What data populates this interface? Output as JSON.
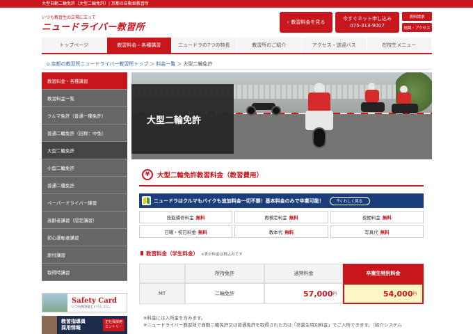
{
  "topbar": {
    "text": "大型自動二輪免許（大型二輪免許）| 京都の自動車教習所"
  },
  "header": {
    "logo_sub": "いつも教習生の立場に立って",
    "logo_main": "ニュードライバー教習所",
    "btn_fee": "教習料金を見る",
    "btn_apply": "今すぐネット申し込み",
    "btn_apply_tel": "075-313-9007",
    "btn_docs": "資料請求",
    "btn_map": "地図・アクセス"
  },
  "gnav": [
    {
      "label": "トップページ",
      "active": false
    },
    {
      "label": "教習料金・各種講習",
      "active": true
    },
    {
      "label": "ニュードラの7つの特長",
      "active": false
    },
    {
      "label": "教習所のご紹介",
      "active": false
    },
    {
      "label": "アクセス・送迎バス",
      "active": false
    },
    {
      "label": "在校生メニュー",
      "active": false
    }
  ],
  "breadcrumb": {
    "home": "京都の教習所ニュードライバー教習所トップ",
    "sep1": "＞",
    "level2": "料金一覧",
    "sep2": "＞",
    "current": "大型二輪免許"
  },
  "sidebar": {
    "items": [
      {
        "label": "教習料金・各種講習",
        "type": "header"
      },
      {
        "label": "教習料金一覧",
        "type": "normal"
      },
      {
        "label": "クルマ免許（普通一種免許）",
        "type": "normal"
      },
      {
        "label": "普通二輪免許（旧称：中免）",
        "type": "normal"
      },
      {
        "label": "大型二輪免許",
        "type": "current"
      },
      {
        "label": "小型二輪免許",
        "type": "normal"
      },
      {
        "label": "普通二種免許",
        "type": "normal"
      },
      {
        "label": "ペーパードライバー練習",
        "type": "normal"
      },
      {
        "label": "高齢者講習（認定講習）",
        "type": "normal"
      },
      {
        "label": "初心運転者講習",
        "type": "normal"
      },
      {
        "label": "原付講習",
        "type": "normal"
      },
      {
        "label": "取得時講習",
        "type": "normal"
      }
    ],
    "safety_title": "Safety Card",
    "safety_sub": "いつも免許証といっしょに。",
    "recruit_line1": "教習指導員",
    "recruit_line2": "採用情報",
    "recruit_entry_1": "正社員採用",
    "recruit_entry_2": "エントリー"
  },
  "hero": {
    "title": "大型二輪免許"
  },
  "section": {
    "icon_char": "¥",
    "title": "大型二輪免許教習料金（教習費用）"
  },
  "banner": {
    "text": "ニュードラはクルマもバイクも追加料金一切不要！基本料金のみで卒業可能！",
    "button": "くわしく見る"
  },
  "free_items": [
    {
      "label": "技能補修料金",
      "value": "無料"
    },
    {
      "label": "再検定料金",
      "value": "無料"
    },
    {
      "label": "夜間料金",
      "value": "無料"
    },
    {
      "label": "日曜・祝日料金",
      "value": "無料"
    },
    {
      "label": "教本代",
      "value": "無料"
    },
    {
      "label": "写真代",
      "value": "無料"
    }
  ],
  "fee_section": {
    "title": "教習料金（学生料金）",
    "note": "※表示料金は税込みです"
  },
  "fee_table": {
    "headers": [
      "",
      "所持免許",
      "通常料金",
      "卒業生特別料金"
    ],
    "rows": [
      {
        "type": "MT",
        "license": "二輪免許",
        "normal": "57,000",
        "special": "54,000",
        "unit": "円"
      }
    ]
  },
  "notes": [
    "※料金には入所金を含みます。",
    "※ニュードライバー教習所で自動二輪免許又は普通免許を取得された方は「卒業生特別料金」でご入所できます。（紹介システム"
  ],
  "colors": {
    "brand_red": "#c8161d",
    "sidebar_gray": "#666666",
    "banner_navy": "#1b3e7a",
    "special_bg": "#fdf6c6"
  }
}
